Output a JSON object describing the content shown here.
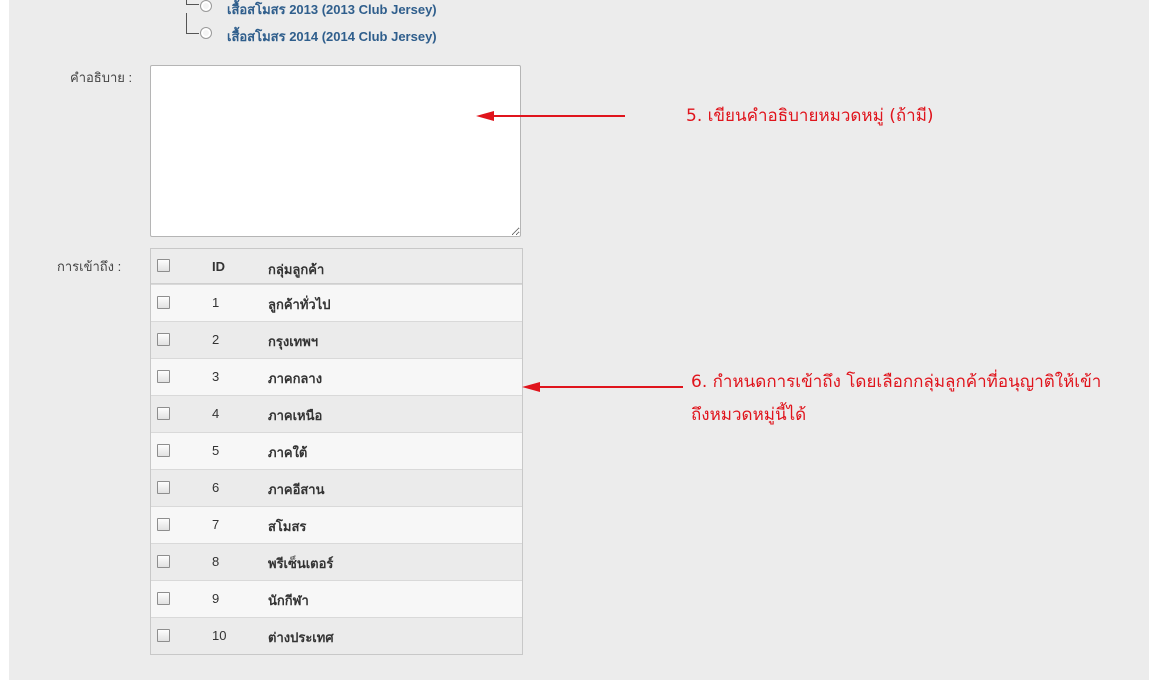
{
  "category_tree": [
    {
      "label": "เสื้อสโมสร 2013 (2013 Club Jersey)"
    },
    {
      "label": "เสื้อสโมสร 2014 (2014 Club Jersey)"
    }
  ],
  "description": {
    "label": "คำอธิบาย :",
    "value": ""
  },
  "access": {
    "label": "การเข้าถึง :",
    "columns": {
      "id": "ID",
      "group": "กลุ่มลูกค้า"
    },
    "rows": [
      {
        "id": "1",
        "name": "ลูกค้าทั่วไป"
      },
      {
        "id": "2",
        "name": "กรุงเทพฯ"
      },
      {
        "id": "3",
        "name": "ภาคกลาง"
      },
      {
        "id": "4",
        "name": "ภาคเหนือ"
      },
      {
        "id": "5",
        "name": "ภาคใต้"
      },
      {
        "id": "6",
        "name": "ภาคอีสาน"
      },
      {
        "id": "7",
        "name": "สโมสร"
      },
      {
        "id": "8",
        "name": "พรีเซ็นเตอร์"
      },
      {
        "id": "9",
        "name": "นักกีฬา"
      },
      {
        "id": "10",
        "name": "ต่างประเทศ"
      }
    ]
  },
  "annotations": {
    "step5": "5. เขียนคำอธิบายหมวดหมู่ (ถ้ามี)",
    "step6_line1": "6. กำหนดการเข้าถึง โดยเลือกกลุ่มลูกค้าที่อนุญาติให้เข้า",
    "step6_line2": "ถึงหมวดหมู่นี้ได้",
    "color": "#e0141c"
  }
}
